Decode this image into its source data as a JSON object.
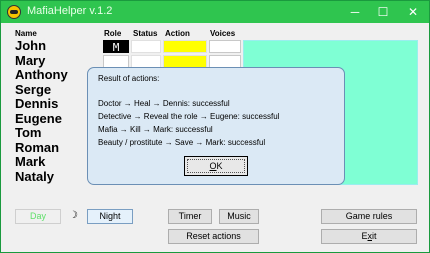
{
  "window": {
    "title": "MafiaHelper v.1.2",
    "minimize": "─",
    "maximize": "☐",
    "close": "✕"
  },
  "table": {
    "headers": {
      "name": "Name",
      "role": "Role",
      "status": "Status",
      "action": "Action",
      "voices": "Voices"
    },
    "players": [
      {
        "name": "John",
        "role": "M"
      },
      {
        "name": "Mary",
        "role": ""
      },
      {
        "name": "Anthony",
        "role": ""
      },
      {
        "name": "Serge",
        "role": ""
      },
      {
        "name": "Dennis",
        "role": ""
      },
      {
        "name": "Eugene",
        "role": ""
      },
      {
        "name": "Tom",
        "role": ""
      },
      {
        "name": "Roman",
        "role": ""
      },
      {
        "name": "Mark",
        "role": ""
      },
      {
        "name": "Nataly",
        "role": ""
      }
    ]
  },
  "dialog": {
    "title": "Result of actions:",
    "lines": [
      "Doctor → Heal → Dennis: successful",
      "Detective → Reveal the role → Eugene: successful",
      "Mafia → Kill → Mark: successful",
      "Beauty / prostitute → Save → Mark: successful"
    ],
    "ok_label": "OK"
  },
  "buttons": {
    "day": "Day",
    "moon": "☽",
    "night": "Night",
    "timer": "Timer",
    "music": "Music",
    "reset": "Reset actions",
    "rules": "Game rules",
    "exit": "Exit"
  },
  "colors": {
    "titlebar": "#2fc54f",
    "action_cells": "#ffff00",
    "board": "#7fffd4",
    "dialog_bg": "#dbe9f5"
  }
}
